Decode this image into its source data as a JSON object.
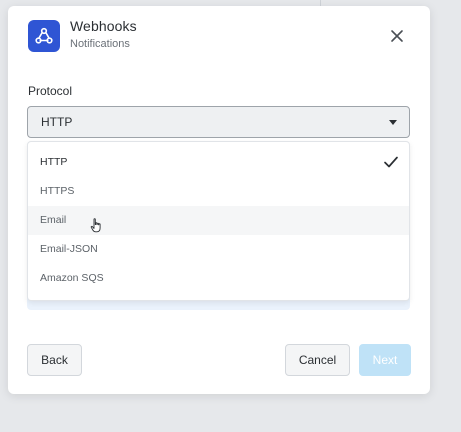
{
  "header": {
    "title": "Webhooks",
    "subtitle": "Notifications",
    "icon": "webhook-icon"
  },
  "protocol": {
    "label": "Protocol",
    "selected_value": "HTTP",
    "options": [
      {
        "label": "HTTP",
        "selected": true
      },
      {
        "label": "HTTPS",
        "selected": false
      },
      {
        "label": "Email",
        "selected": false,
        "hovered": true
      },
      {
        "label": "Email-JSON",
        "selected": false
      },
      {
        "label": "Amazon SQS",
        "selected": false
      }
    ]
  },
  "footer": {
    "back_label": "Back",
    "cancel_label": "Cancel",
    "next_label": "Next",
    "next_disabled": true
  },
  "colors": {
    "brand": "#2f55d4",
    "next_disabled": "#bfe2f7"
  }
}
